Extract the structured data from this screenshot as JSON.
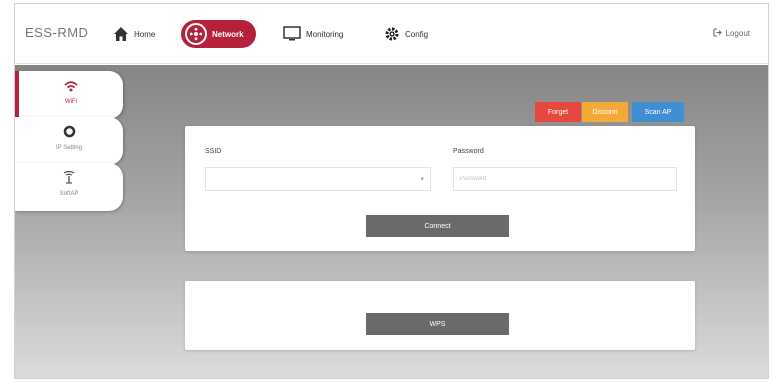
{
  "header": {
    "brand": "ESS-RMD",
    "nav": [
      {
        "label": "Home",
        "icon": "home-icon"
      },
      {
        "label": "Network",
        "icon": "network-icon",
        "active": true
      },
      {
        "label": "Monitoring",
        "icon": "monitor-icon"
      },
      {
        "label": "Config",
        "icon": "gear-icon"
      }
    ],
    "logout": "Logout"
  },
  "sidebar": {
    "tabs": [
      {
        "label": "WiFi",
        "icon": "wifi-icon",
        "active": true
      },
      {
        "label": "IP Setting",
        "icon": "settings-icon"
      },
      {
        "label": "SoftAP",
        "icon": "antenna-icon"
      }
    ]
  },
  "actions": {
    "forget": "Forget",
    "disconnect": "Disconn",
    "scan": "Scan AP"
  },
  "wifi_form": {
    "ssid_label": "SSID",
    "ssid_value": "",
    "password_label": "Password",
    "password_placeholder": "Password",
    "connect_label": "Connect"
  },
  "wps": {
    "button_label": "WPS"
  },
  "colors": {
    "accent": "#b5203a",
    "forget": "#e4493c",
    "disconnect": "#f3a93a",
    "scan": "#3f8fd2",
    "button_dark": "#6a6a6a"
  }
}
